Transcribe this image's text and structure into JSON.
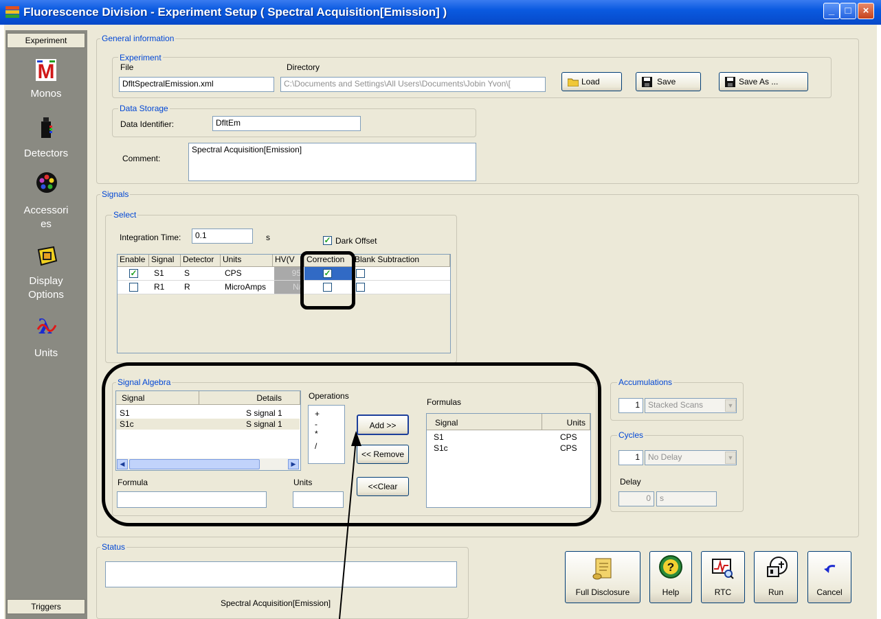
{
  "window": {
    "title": "Fluorescence Division - Experiment Setup ( Spectral Acquisition[Emission] )",
    "controls": {
      "minimize": "_",
      "maximize": "□",
      "close": "×"
    }
  },
  "sidebar": {
    "top_tab": "Experiment",
    "bottom_tab": "Triggers",
    "items": [
      {
        "label": "Monos",
        "icon": "monos-icon"
      },
      {
        "label": "Detectors",
        "icon": "detectors-icon"
      },
      {
        "label": "Accessori es",
        "label_lines": [
          "Accessori",
          "es"
        ],
        "icon": "accessories-icon"
      },
      {
        "label": "Display Options",
        "label_lines": [
          "Display",
          "Options"
        ],
        "icon": "display-options-icon"
      },
      {
        "label": "Units",
        "icon": "units-icon"
      }
    ]
  },
  "general": {
    "title": "General information",
    "experiment": {
      "title": "Experiment",
      "file_label": "File",
      "file_value": "DfltSpectralEmission.xml",
      "directory_label": "Directory",
      "directory_value": "C:\\Documents and Settings\\All Users\\Documents\\Jobin Yvon\\[",
      "load": "Load",
      "save": "Save",
      "save_as": "Save As ..."
    },
    "data_storage": {
      "title": "Data Storage",
      "identifier_label": "Data Identifier:",
      "identifier_value": "DfltEm"
    },
    "comment_label": "Comment:",
    "comment_value": "Spectral Acquisition[Emission]"
  },
  "signals": {
    "title": "Signals",
    "select": {
      "title": "Select",
      "integration_label": "Integration Time:",
      "integration_value": "0.1",
      "integration_unit": "s",
      "dark_offset_label": "Dark Offset",
      "dark_offset_checked": true,
      "columns": [
        "Enable",
        "Signal",
        "Detector",
        "Units",
        "HV(V",
        "Correction",
        "Blank Subtraction"
      ],
      "rows": [
        {
          "enable": true,
          "signal": "S1",
          "detector": "S",
          "units": "CPS",
          "hv": "95",
          "correction": true,
          "blank": false
        },
        {
          "enable": false,
          "signal": "R1",
          "detector": "R",
          "units": "MicroAmps",
          "hv": "N/",
          "correction": false,
          "blank": false
        }
      ]
    },
    "algebra": {
      "title": "Signal Algebra",
      "list_headers": [
        "Signal",
        "Details"
      ],
      "list_rows": [
        {
          "signal": "S1",
          "details": "S signal 1"
        },
        {
          "signal": "S1c",
          "details": "S signal 1"
        }
      ],
      "operations_label": "Operations",
      "operations": [
        "+",
        "-",
        "*",
        "/"
      ],
      "add": "Add >>",
      "remove": "<< Remove",
      "clear": "<<Clear",
      "formula_label": "Formula",
      "formula_value": "",
      "units_label": "Units",
      "units_value": "",
      "formulas_label": "Formulas",
      "formulas_headers": [
        "Signal",
        "Units"
      ],
      "formulas_rows": [
        {
          "signal": "S1",
          "units": "CPS"
        },
        {
          "signal": "S1c",
          "units": "CPS"
        }
      ]
    },
    "accumulations": {
      "title": "Accumulations",
      "count": "1",
      "mode": "Stacked Scans"
    },
    "cycles": {
      "title": "Cycles",
      "count": "1",
      "mode": "No Delay",
      "delay_label": "Delay",
      "delay_value": "0",
      "delay_unit": "s"
    }
  },
  "status": {
    "title": "Status",
    "text": "",
    "caption": "Spectral Acquisition[Emission]"
  },
  "buttons": {
    "full_disclosure": "Full Disclosure",
    "help": "Help",
    "rtc": "RTC",
    "run": "Run",
    "cancel": "Cancel"
  },
  "colors": {
    "title_bar": "#0a5ae0",
    "group_label": "#0046d5",
    "sidebar": "#8a8a82",
    "selection": "#316ac5",
    "annotation": "#000000"
  }
}
